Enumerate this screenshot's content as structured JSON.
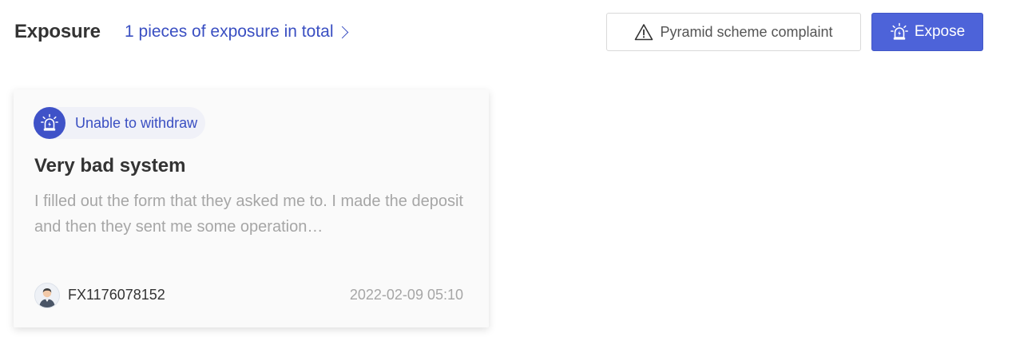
{
  "header": {
    "title": "Exposure",
    "total_link": "1 pieces of exposure in total",
    "complaint_button": "Pyramid scheme complaint",
    "expose_button": "Expose"
  },
  "colors": {
    "accent": "#4d63d9",
    "link": "#3a4fc2",
    "muted_text": "#a6a6a6"
  },
  "icons": {
    "complaint": "warning-triangle-icon",
    "expose": "alarm-siren-icon",
    "tag": "alarm-siren-icon",
    "link": "chevron-right-icon"
  },
  "cards": [
    {
      "tag": "Unable to withdraw",
      "title": "Very bad system",
      "description": "I filled out the form that they asked me to. I made the deposit and then they sent me some operation…",
      "user": "FX1176078152",
      "time": "2022-02-09 05:10"
    }
  ]
}
